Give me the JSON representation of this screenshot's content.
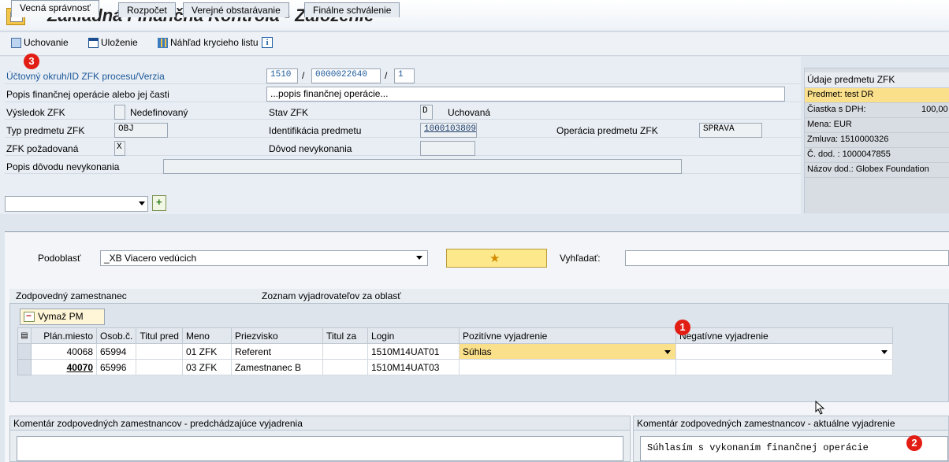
{
  "window": {
    "title": "Základná Finančná Kontrola - Založenie"
  },
  "toolbar": {
    "uchovanie": "Uchovanie",
    "ulozenie": "Uloženie",
    "nahlad": "Náhľad krycieho listu"
  },
  "form": {
    "uctovny_label": "Účtovný okruh/ID ZFK procesu/Verzia",
    "okruh": "1510",
    "sep1": "/",
    "id_zfk": "0000022640",
    "sep2": "/",
    "verzia": "1",
    "popis_label": "Popis finančnej operácie alebo jej časti",
    "popis_value": "...popis finančnej operácie...",
    "vysledok_label": "Výsledok ZFK",
    "vysledok_value": "Nedefinovaný",
    "stav_label": "Stav ZFK",
    "stav_code": "D",
    "stav_value": "Uchovaná",
    "typ_label": "Typ predmetu ZFK",
    "typ_value": "OBJ",
    "ident_label": "Identifikácia predmetu",
    "ident_value": "1000103809",
    "operacia_label": "Operácia predmetu ZFK",
    "operacia_value": "SPRAVA",
    "pozadovana_label": "ZFK požadovaná",
    "pozadovana_value": "X",
    "dovod_label": "Dôvod nevykonania",
    "popis_dovodu_label": "Popis dôvodu nevykonania"
  },
  "zfk_panel": {
    "header": "Údaje predmetu ZFK",
    "predmet": "Predmet: test DR",
    "ciastka_label": "Čiastka s DPH:",
    "ciastka_value": "100,00",
    "mena": "Mena: EUR",
    "zmluva": "Zmluva: 1510000326",
    "c_dod": "Č. dod. : 1000047855",
    "nazov": "Názov dod.: Globex Foundation"
  },
  "tabs": [
    {
      "label": "Vecná správnosť",
      "active": true
    },
    {
      "label": "Rozpočet"
    },
    {
      "label": "Verejné obstarávanie"
    },
    {
      "label": "Finálne schválenie"
    }
  ],
  "subarea": {
    "podoblast_label": "Podoblasť",
    "podoblast_value": "_XB Viacero vedúcich",
    "vyhladat_label": "Vyhľadať:"
  },
  "employees": {
    "section_left": "Zodpovedný zamestnanec",
    "section_right": "Zoznam vyjadrovateľov za oblasť",
    "delete_button": "Vymaž PM",
    "columns": [
      "Plán.miesto",
      "Osob.č.",
      "Titul pred",
      "Meno",
      "Priezvisko",
      "Titul za",
      "Login",
      "Pozitívne vyjadrenie",
      "Negatívne vyjadrenie"
    ],
    "rows": [
      {
        "plan": "40068",
        "osob": "65994",
        "titul_pred": "",
        "meno": "01 ZFK",
        "priezvisko": "Referent",
        "titul_za": "",
        "login": "1510M14UAT01",
        "pozitivne": "Súhlas",
        "negativne": ""
      },
      {
        "plan": "40070",
        "osob": "65996",
        "titul_pred": "",
        "meno": "03 ZFK",
        "priezvisko": "Zamestnanec B",
        "titul_za": "",
        "login": "1510M14UAT03",
        "pozitivne": "",
        "negativne": ""
      }
    ]
  },
  "comments": {
    "left_header": "Komentár zodpovedných zamestnancov - predchádzajúce vyjadrenia",
    "right_header": "Komentár zodpovedných zamestnancov - aktuálne vyjadrenie",
    "right_text": "Súhlasím s vykonaním finančnej operácie"
  },
  "badges": {
    "b1": "1",
    "b2": "2",
    "b3": "3"
  },
  "colors": {
    "badge": "#e21d14",
    "highlight": "#fbe08b",
    "link": "#1a5799"
  }
}
